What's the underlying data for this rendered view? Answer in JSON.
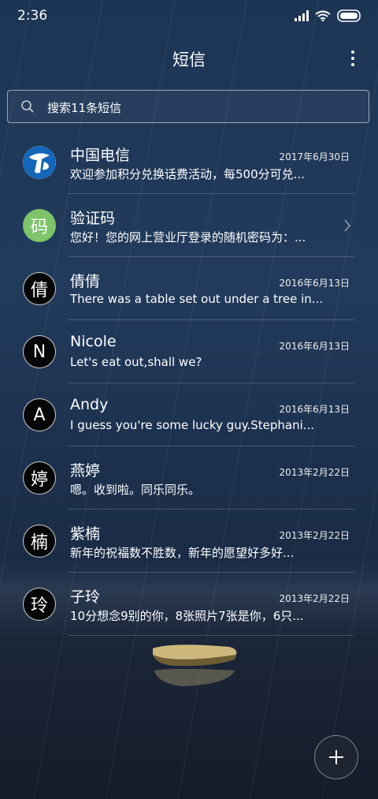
{
  "status_bar": {
    "time": "2:36",
    "icons": [
      "signal-icon",
      "wifi-icon",
      "battery-icon"
    ]
  },
  "header": {
    "title": "短信",
    "menu_icon": "more-vertical-icon"
  },
  "search": {
    "placeholder": "搜索11条短信",
    "icon": "search-icon"
  },
  "conversations": [
    {
      "avatar": "",
      "avatar_icon": "china-telecom-logo-icon",
      "name": "中国电信",
      "date": "2017年6月30日",
      "preview": "欢迎参加积分兑换话费活动，每500分可兑..."
    },
    {
      "avatar": "码",
      "name": "验证码",
      "date": "",
      "preview": "您好！您的网上营业厅登录的随机密码为：...",
      "has_chevron": true
    },
    {
      "avatar": "倩",
      "name": "倩倩",
      "date": "2016年6月13日",
      "preview": "There was a table set out under a tree in..."
    },
    {
      "avatar": "N",
      "name": "Nicole",
      "date": "2016年6月13日",
      "preview": "Let's eat out,shall we?"
    },
    {
      "avatar": "A",
      "name": "Andy",
      "date": "2016年6月13日",
      "preview": "I guess you're some lucky guy.Stephani..."
    },
    {
      "avatar": "婷",
      "name": "燕婷",
      "date": "2013年2月22日",
      "preview": "嗯。收到啦。同乐同乐。"
    },
    {
      "avatar": "楠",
      "name": "紫楠",
      "date": "2013年2月22日",
      "preview": "新年的祝福数不胜数，新年的愿望好多好..."
    },
    {
      "avatar": "玲",
      "name": "子玲",
      "date": "2013年2月22日",
      "preview": "10分想念9别的你，8张照片7张是你，6只..."
    }
  ],
  "fab": {
    "icon": "plus-icon"
  },
  "colors": {
    "avatar_green": "#7dc46a",
    "telecom_blue": "#1466b8"
  }
}
